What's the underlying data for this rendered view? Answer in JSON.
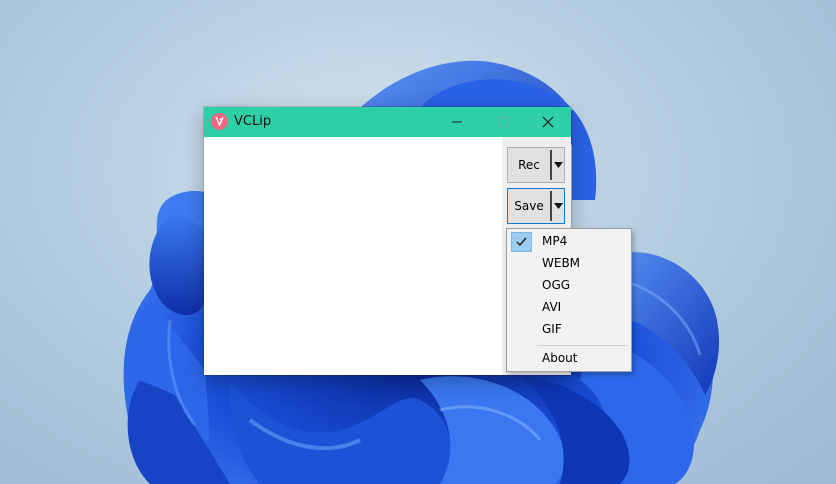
{
  "window": {
    "title": "VCLip",
    "title_bar_color": "#2ecfa6",
    "app_icon": "vclip-app-icon",
    "controls": {
      "minimize_icon": "minimize-icon",
      "maximize_icon": "maximize-icon",
      "close_icon": "close-icon"
    }
  },
  "buttons": {
    "rec_label": "Rec",
    "save_label": "Save",
    "dropdown_icon": "dropdown-arrow-icon"
  },
  "menu": {
    "items": [
      {
        "label": "MP4",
        "checked": true
      },
      {
        "label": "WEBM",
        "checked": false
      },
      {
        "label": "OGG",
        "checked": false
      },
      {
        "label": "AVI",
        "checked": false
      },
      {
        "label": "GIF",
        "checked": false
      }
    ],
    "about_label": "About",
    "check_icon": "checkmark-icon",
    "highlight_color": "#9ccbf0"
  },
  "colors": {
    "accent": "#0078d7",
    "wallpaper_blue": "#1f5fe0"
  }
}
